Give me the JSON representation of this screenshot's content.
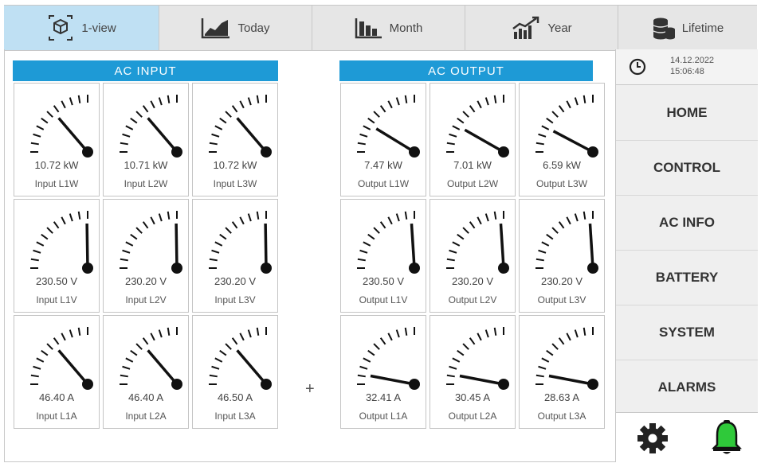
{
  "tabs": [
    {
      "label": "1-view",
      "icon": "cube-icon",
      "active": true
    },
    {
      "label": "Today",
      "icon": "area-chart-icon",
      "active": false
    },
    {
      "label": "Month",
      "icon": "bar-chart-icon",
      "active": false
    },
    {
      "label": "Year",
      "icon": "trend-chart-icon",
      "active": false
    },
    {
      "label": "Lifetime",
      "icon": "database-icon",
      "active": false
    }
  ],
  "ac_input": {
    "title": "AC INPUT",
    "gauges": [
      {
        "value": "10.72 kW",
        "label": "Input L1W",
        "level": 0.55
      },
      {
        "value": "10.71 kW",
        "label": "Input L2W",
        "level": 0.55
      },
      {
        "value": "10.72 kW",
        "label": "Input L3W",
        "level": 0.55
      },
      {
        "value": "230.50 V",
        "label": "Input L1V",
        "level": 0.99
      },
      {
        "value": "230.20 V",
        "label": "Input L2V",
        "level": 0.99
      },
      {
        "value": "230.20 V",
        "label": "Input L3V",
        "level": 0.99
      },
      {
        "value": "46.40 A",
        "label": "Input L1A",
        "level": 0.55
      },
      {
        "value": "46.40 A",
        "label": "Input L2A",
        "level": 0.55
      },
      {
        "value": "46.50 A",
        "label": "Input L3A",
        "level": 0.55
      }
    ]
  },
  "ac_output": {
    "title": "AC OUTPUT",
    "gauges": [
      {
        "value": "7.47 kW",
        "label": "Output L1W",
        "level": 0.35
      },
      {
        "value": "7.01 kW",
        "label": "Output L2W",
        "level": 0.33
      },
      {
        "value": "6.59 kW",
        "label": "Output L3W",
        "level": 0.31
      },
      {
        "value": "230.50 V",
        "label": "Output L1V",
        "level": 0.96
      },
      {
        "value": "230.20 V",
        "label": "Output L2V",
        "level": 0.96
      },
      {
        "value": "230.20 V",
        "label": "Output L3V",
        "level": 0.96
      },
      {
        "value": "32.41 A",
        "label": "Output L1A",
        "level": 0.12
      },
      {
        "value": "30.45 A",
        "label": "Output L2A",
        "level": 0.12
      },
      {
        "value": "28.63 A",
        "label": "Output L3A",
        "level": 0.12
      }
    ]
  },
  "plus_symbol": "+",
  "clock": {
    "date": "14.12.2022",
    "time": "15:06:48"
  },
  "menu": [
    "HOME",
    "CONTROL",
    "AC INFO",
    "BATTERY",
    "SYSTEM",
    "ALARMS"
  ],
  "colors": {
    "header": "#1e9ad6",
    "active_tab": "#bfe0f3",
    "bell": "#2fc93a",
    "gauge": "#111111"
  },
  "footer_icons": [
    "gear-icon",
    "bell-icon"
  ]
}
